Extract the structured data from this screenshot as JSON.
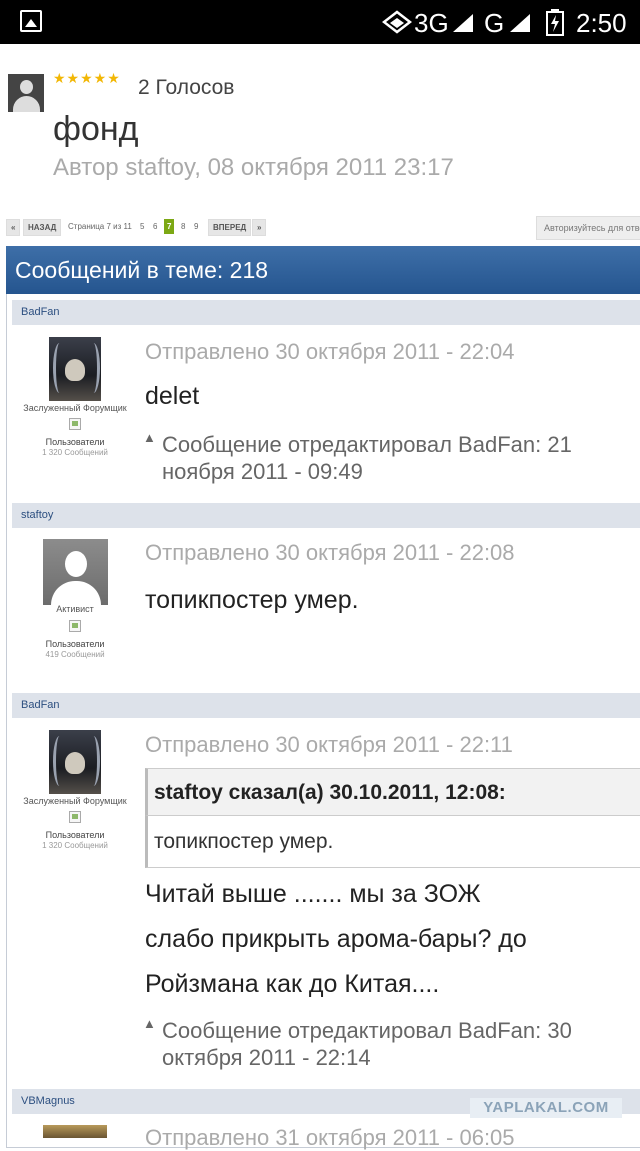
{
  "status_bar": {
    "network": "3G",
    "network2": "G",
    "time": "2:50"
  },
  "topic": {
    "votes": "2 Голосов",
    "title": "фонд",
    "author_line": "Автор staftoy, 08 октября 2011 23:17",
    "stars": "★★★★★"
  },
  "pagination": {
    "prev": "«",
    "back": "НАЗАД",
    "page_label": "Страница 7 из 11",
    "pages": [
      "5",
      "6",
      "7",
      "8",
      "9"
    ],
    "current": "7",
    "forward": "ВПЕРЕД",
    "next": "»",
    "login": "Авторизуйтесь для ответа"
  },
  "thread": {
    "header": "Сообщений в теме: 218"
  },
  "posts": [
    {
      "author": "BadFan",
      "rank": "Заслуженный Форумщик",
      "group": "Пользователи",
      "count": "1 320 Сообщений",
      "sent": "Отправлено 30 октября 2011 - 22:04",
      "text": "delet",
      "edit_line1": "Сообщение отредактировал BadFan: 21",
      "edit_line2": "ноября 2011 - 09:49"
    },
    {
      "author": "staftoy",
      "rank": "Активист",
      "group": "Пользователи",
      "count": "419 Сообщений",
      "sent": "Отправлено 30 октября 2011 - 22:08",
      "text": "топикпостер умер."
    },
    {
      "author": "BadFan",
      "rank": "Заслуженный Форумщик",
      "group": "Пользователи",
      "count": "1 320 Сообщений",
      "sent": "Отправлено 30 октября 2011 - 22:11",
      "quote_header": "staftoy сказал(а) 30.10.2011, 12:08:",
      "quote_text": "топикпостер умер.",
      "reply_lines": [
        "Читай выше ....... мы за ЗОЖ",
        "слабо прикрыть арома-бары? до",
        "Ройзмана как до Китая...."
      ],
      "edit_line1": "Сообщение отредактировал BadFan: 30",
      "edit_line2": "октября 2011 - 22:14"
    },
    {
      "author": "VBMagnus",
      "sent": "Отправлено 31 октября 2011 - 06:05"
    }
  ],
  "watermark": "YAPLAKAL.COM"
}
